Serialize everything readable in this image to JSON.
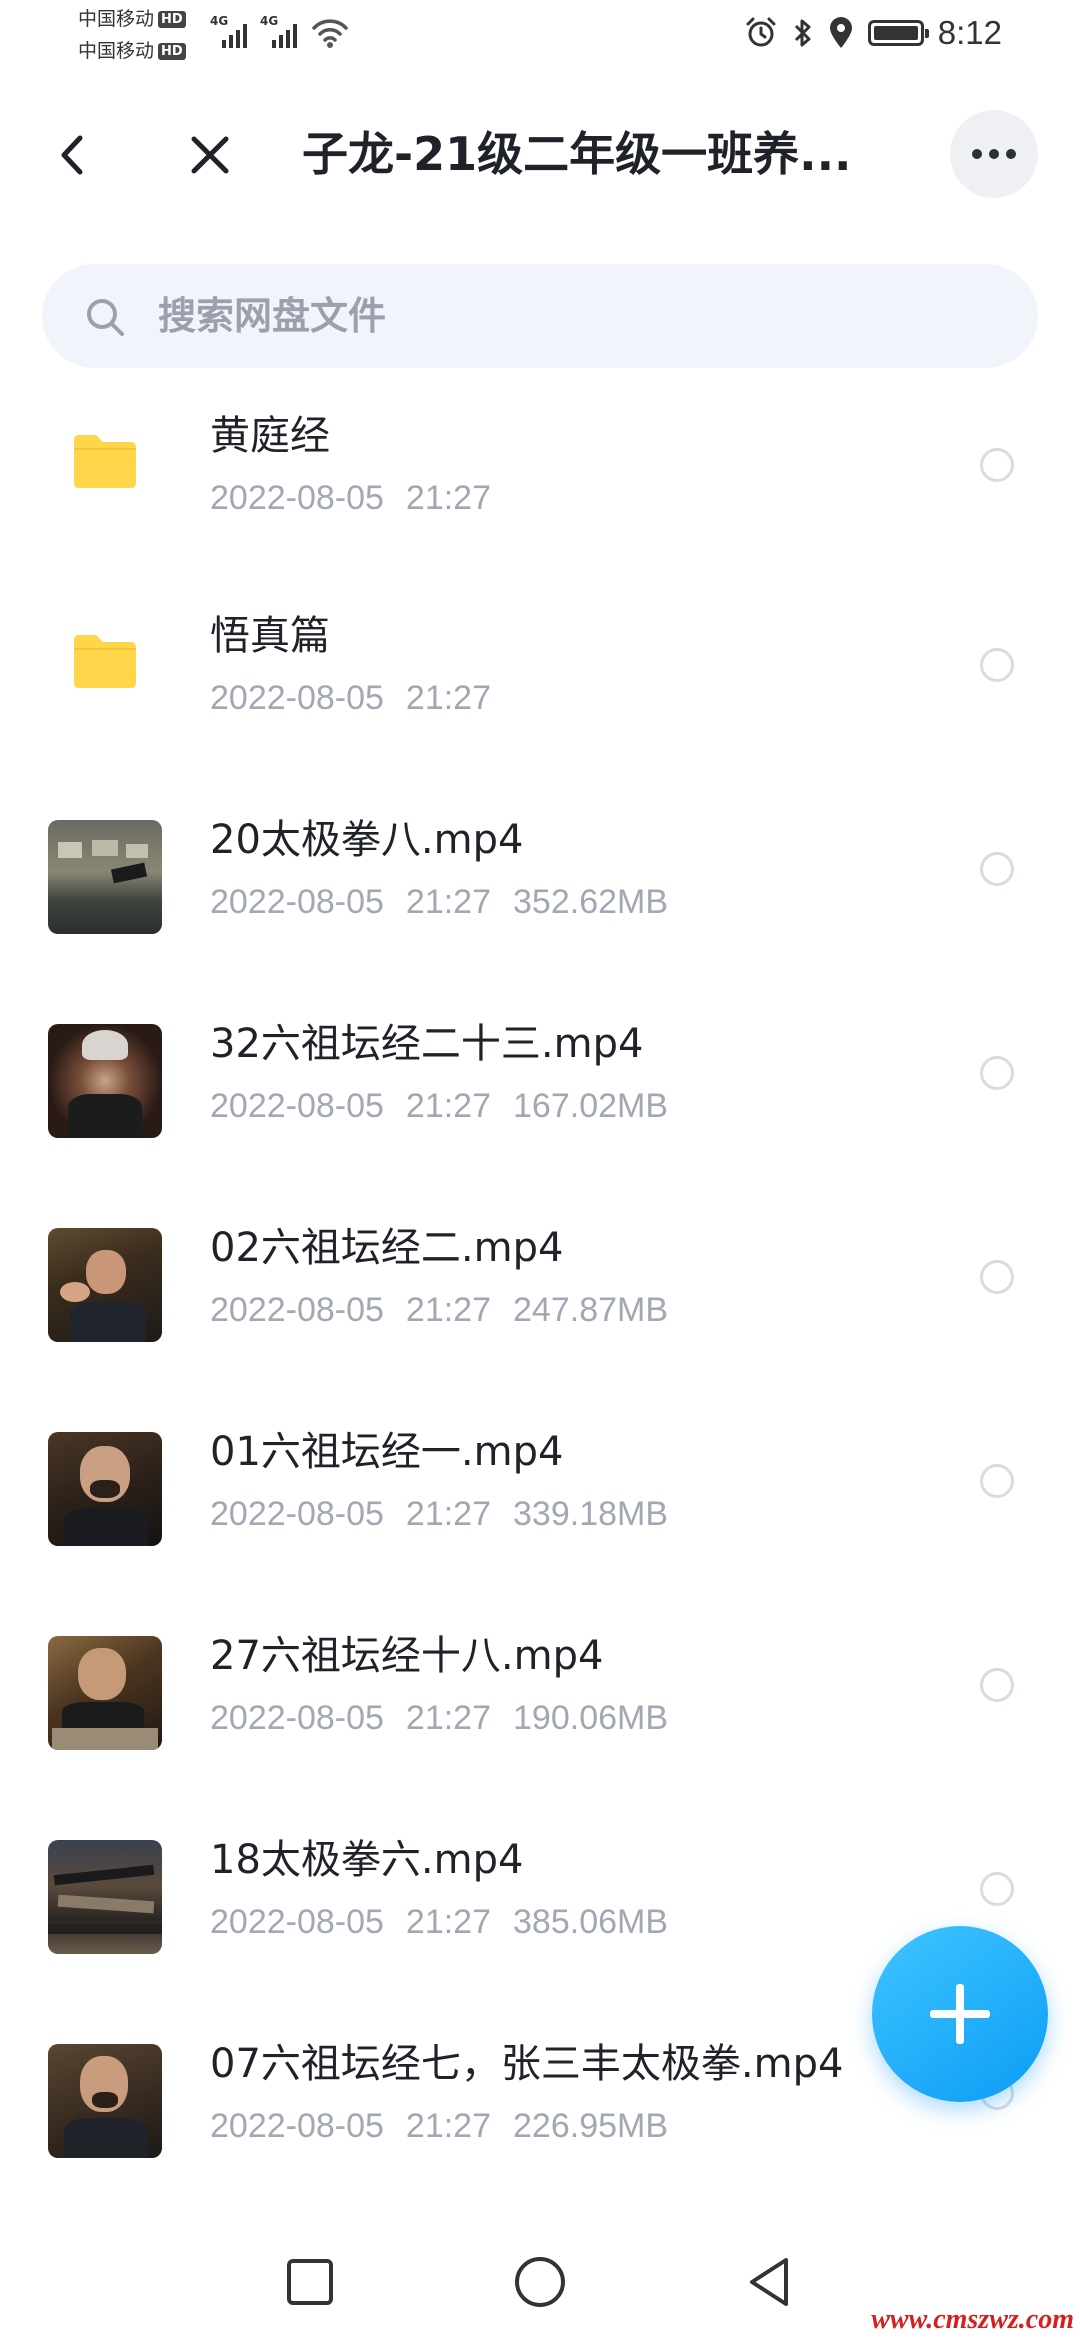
{
  "status_bar": {
    "carrier_1": "中国移动",
    "carrier_2": "中国移动",
    "hd_badge": "HD",
    "network_1": "4G",
    "network_2": "4G",
    "time": "8:12",
    "icons": [
      "alarm-icon",
      "bluetooth-icon",
      "location-icon",
      "battery-icon"
    ]
  },
  "header": {
    "title": "子龙-21级二年级一班养..."
  },
  "search": {
    "placeholder": "搜索网盘文件"
  },
  "files": [
    {
      "name": "黄庭经",
      "date": "2022-08-05",
      "time": "21:27",
      "size": "",
      "type": "folder"
    },
    {
      "name": "悟真篇",
      "date": "2022-08-05",
      "time": "21:27",
      "size": "",
      "type": "folder"
    },
    {
      "name": "20太极拳八.mp4",
      "date": "2022-08-05",
      "time": "21:27",
      "size": "352.62MB",
      "type": "video"
    },
    {
      "name": "32六祖坛经二十三.mp4",
      "date": "2022-08-05",
      "time": "21:27",
      "size": "167.02MB",
      "type": "video"
    },
    {
      "name": "02六祖坛经二.mp4",
      "date": "2022-08-05",
      "time": "21:27",
      "size": "247.87MB",
      "type": "video"
    },
    {
      "name": "01六祖坛经一.mp4",
      "date": "2022-08-05",
      "time": "21:27",
      "size": "339.18MB",
      "type": "video"
    },
    {
      "name": "27六祖坛经十八.mp4",
      "date": "2022-08-05",
      "time": "21:27",
      "size": "190.06MB",
      "type": "video"
    },
    {
      "name": "18太极拳六.mp4",
      "date": "2022-08-05",
      "time": "21:27",
      "size": "385.06MB",
      "type": "video"
    },
    {
      "name": "07六祖坛经七，张三丰太极拳.mp4",
      "date": "2022-08-05",
      "time": "21:27",
      "size": "226.95MB",
      "type": "video"
    }
  ],
  "colors": {
    "accent": "#1aa8fa",
    "folder": "#ffd54a",
    "meta_text": "#a2a8b3",
    "search_bg": "#f1f4fa"
  },
  "watermark": "www.cmszwz.com"
}
